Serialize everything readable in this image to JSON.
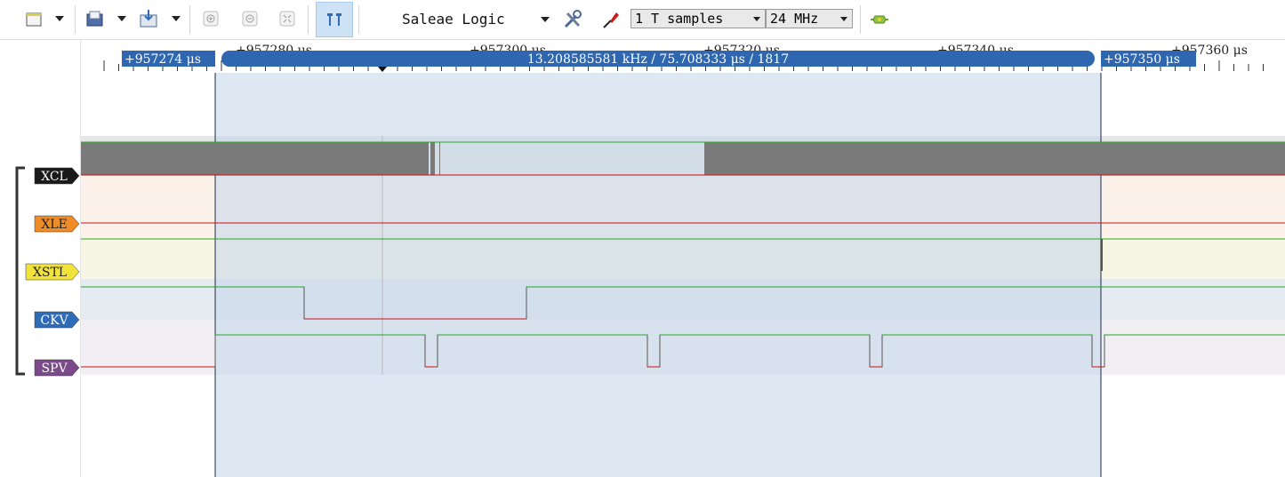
{
  "toolbar": {
    "device_name": "Saleae Logic",
    "samples": "1 T samples",
    "rate": "24 MHz"
  },
  "ruler": {
    "ticks": [
      "+957280 μs",
      "+957300 μs",
      "+957320 μs",
      "+957340 μs",
      "+957360 μs"
    ],
    "left_marker": "+957274 μs",
    "right_marker": "+957350 μs",
    "measurement": "13.208585581 kHz / 75.708333 μs / 1817"
  },
  "channels": [
    {
      "name": "XCL",
      "color": "#1a1a1a",
      "text": "#ffffff"
    },
    {
      "name": "XLE",
      "color": "#f08c28",
      "text": "#222222"
    },
    {
      "name": "XSTL",
      "color": "#f2e33a",
      "text": "#222222"
    },
    {
      "name": "CKV",
      "color": "#2f6cb8",
      "text": "#ffffff"
    },
    {
      "name": "SPV",
      "color": "#7a4a8a",
      "text": "#ffffff"
    }
  ],
  "colors": {
    "selection": "#c3d5ea",
    "high_line": "#22aa22",
    "low_line": "#cc1111",
    "marker_bar": "#2e66b0"
  },
  "icons": [
    "new-file-icon",
    "open-icon",
    "save-icon",
    "zoom-in-icon",
    "zoom-out-icon",
    "zoom-fit-icon",
    "cursor-marker-icon",
    "settings-icon",
    "trigger-icon",
    "analyzer-icon"
  ]
}
